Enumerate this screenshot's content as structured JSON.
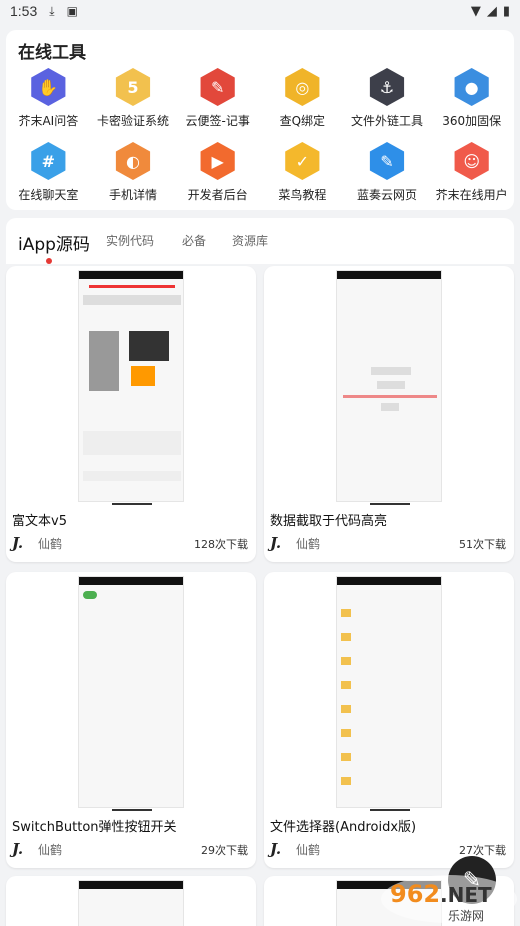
{
  "status_bar": {
    "time": "1:53"
  },
  "tools": {
    "title": "在线工具",
    "items": [
      {
        "label": "芥末AI问答",
        "color": "#5a62e0",
        "glyph": "✋"
      },
      {
        "label": "卡密验证系统",
        "color": "#f2c14e",
        "glyph": "5"
      },
      {
        "label": "云便签-记事",
        "color": "#e2483b",
        "glyph": "✎"
      },
      {
        "label": "查Q绑定",
        "color": "#f0b429",
        "glyph": "◎"
      },
      {
        "label": "文件外链工具",
        "color": "#3d3f4a",
        "glyph": "⚓"
      },
      {
        "label": "360加固保",
        "color": "#3b8ee0",
        "glyph": "●"
      },
      {
        "label": "在线聊天室",
        "color": "#3aa0e8",
        "glyph": "#"
      },
      {
        "label": "手机详情",
        "color": "#f08a3c",
        "glyph": "◐"
      },
      {
        "label": "开发者后台",
        "color": "#f26a2e",
        "glyph": "▶"
      },
      {
        "label": "菜鸟教程",
        "color": "#f4b82c",
        "glyph": "✓"
      },
      {
        "label": "蓝奏云网页",
        "color": "#2e8fe8",
        "glyph": "✎"
      },
      {
        "label": "芥末在线用户",
        "color": "#f05a4a",
        "glyph": "☺"
      }
    ]
  },
  "tabs": [
    {
      "label": "iApp源码",
      "active": true
    },
    {
      "label": "实例代码",
      "active": false
    },
    {
      "label": "必备",
      "active": false
    },
    {
      "label": "资源库",
      "active": false
    }
  ],
  "cards": [
    {
      "name": "富文本v5",
      "author": "仙鹤",
      "downloads": "128次下载"
    },
    {
      "name": "数据截取于代码高亮",
      "author": "仙鹤",
      "downloads": "51次下载"
    },
    {
      "name": "SwitchButton弹性按钮开关",
      "author": "仙鹤",
      "downloads": "29次下载"
    },
    {
      "name": "文件选择器(Androidx版)",
      "author": "仙鹤",
      "downloads": "27次下载"
    }
  ],
  "fab": {
    "icon": "pen-icon"
  },
  "watermark": {
    "text": "962.NET 乐游网"
  }
}
